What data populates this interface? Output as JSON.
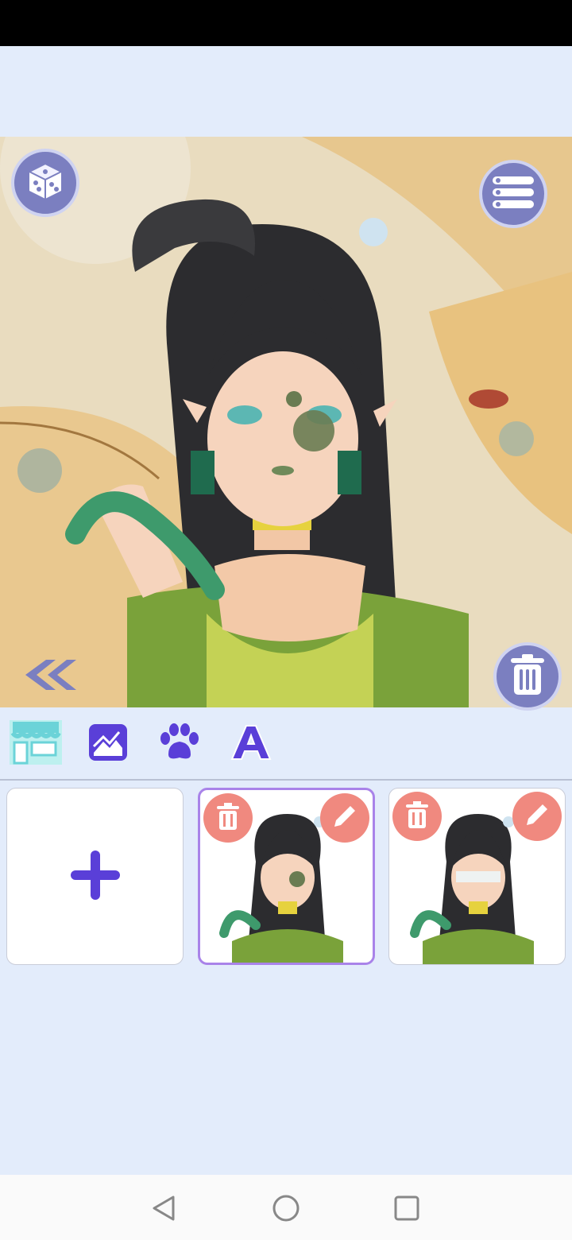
{
  "app": {
    "canvas_label": "",
    "icons": {
      "randomize": "dice-icon",
      "menu": "list-icon",
      "delete_character": "trash-icon",
      "back": "double-chevron-left-icon"
    }
  },
  "toolbar": {
    "tabs": [
      {
        "name": "shop",
        "icon": "shop-icon",
        "active": true
      },
      {
        "name": "background",
        "icon": "image-icon",
        "active": false
      },
      {
        "name": "pets",
        "icon": "paw-icon",
        "active": false
      },
      {
        "name": "text",
        "icon": "letter-a-icon",
        "active": false
      }
    ]
  },
  "saved_slots": {
    "add_icon": "plus-icon",
    "selected_index": 1,
    "slot_icons": {
      "delete": "trash-icon",
      "edit": "pencil-icon"
    }
  },
  "colors": {
    "accent": "#6a4fe0",
    "button_bg": "#7b7fc0",
    "slot_action_bg": "#f0897f",
    "selected_border": "#a983e9",
    "page_bg": "#e3ecfb"
  },
  "system_nav": {
    "back": "triangle-back-icon",
    "home": "circle-home-icon",
    "recent": "square-recent-icon"
  }
}
